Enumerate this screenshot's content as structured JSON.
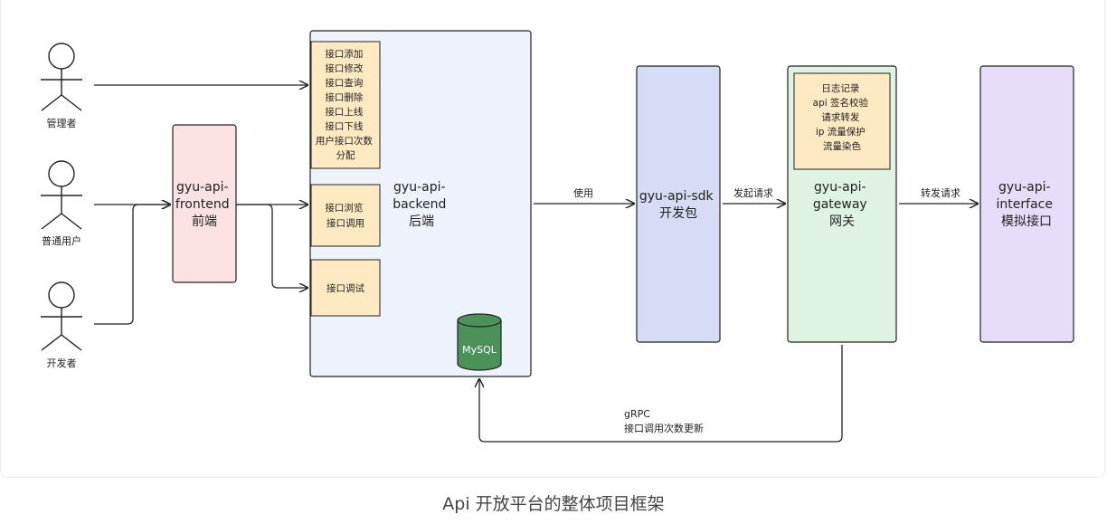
{
  "actors": {
    "admin": "管理者",
    "user": "普通用户",
    "developer": "开发者"
  },
  "frontend": {
    "lines": [
      "gyu-api-",
      "frontend",
      "前端"
    ]
  },
  "backend": {
    "lines": [
      "gyu-api-",
      "backend",
      "后端"
    ],
    "admin_features": [
      "接口添加",
      "接口修改",
      "接口查询",
      "接口删除",
      "接口上线",
      "接口下线",
      "用户接口次数",
      "分配"
    ],
    "user_features": [
      "接口浏览",
      "接口调用"
    ],
    "dev_features": [
      "接口调试"
    ],
    "database": "MySQL"
  },
  "sdk": {
    "lines": [
      "gyu-api-sdk",
      "开发包"
    ]
  },
  "gateway": {
    "lines": [
      "gyu-api-",
      "gateway",
      "网关"
    ],
    "features": [
      "日志记录",
      "api 签名校验",
      "请求转发",
      "ip 流量保护",
      "流量染色"
    ]
  },
  "interface": {
    "lines": [
      "gyu-api-",
      "interface",
      "模拟接口"
    ]
  },
  "edges": {
    "use": "使用",
    "send_request": "发起请求",
    "forward_request": "转发请求",
    "grpc": "gRPC",
    "grpc_desc": "接口调用次数更新"
  },
  "caption": "Api 开放平台的整体项目框架",
  "colors": {
    "frontend_fill": "#fde2e4",
    "backend_fill": "#eef3fb",
    "feature_fill": "#fdeac3",
    "sdk_fill": "#d6dcf5",
    "gateway_fill": "#dff3e3",
    "interface_fill": "#e7dcf9",
    "db_fill": "#4a9259"
  }
}
